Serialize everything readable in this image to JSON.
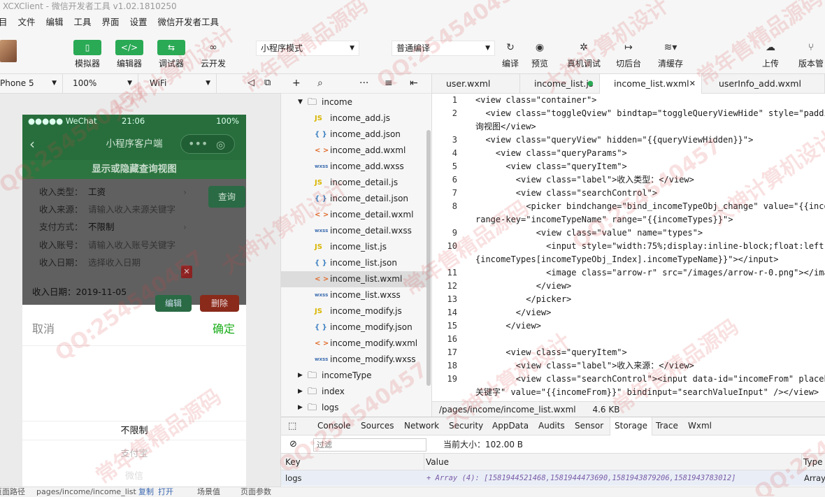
{
  "window": {
    "title": "XCXClient - 微信开发者工具 v1.02.1810250"
  },
  "menu": [
    "目",
    "文件",
    "编辑",
    "工具",
    "界面",
    "设置",
    "微信开发者工具"
  ],
  "toolbar": {
    "simulator": "模拟器",
    "editor": "编辑器",
    "debugger": "调试器",
    "cloud": "云开发",
    "mode": "小程序模式",
    "compile_mode": "普通编译",
    "compile": "编译",
    "preview": "预览",
    "remote_debug": "真机调试",
    "background": "切后台",
    "clear_cache": "清缓存",
    "upload": "上传",
    "version": "版本管"
  },
  "device_bar": {
    "device": "Phone 5",
    "zoom": "100%",
    "network": "WiFi"
  },
  "phone": {
    "carrier": "●●●●● WeChat",
    "time": "21:06",
    "battery": "100%",
    "nav_title": "小程序客户端",
    "toggle_label": "显示或隐藏查询视图",
    "query_button": "查询",
    "form": [
      {
        "label": "收入类型：",
        "value": "工资"
      },
      {
        "label": "收入来源：",
        "value": "请输入收入来源关键字"
      },
      {
        "label": "支付方式：",
        "value": "不限制"
      },
      {
        "label": "收入账号：",
        "value": "请输入收入账号关键字"
      },
      {
        "label": "收入日期：",
        "value": "选择收入日期"
      }
    ],
    "record_date": "收入日期：2019-11-05",
    "edit_button": "编辑",
    "delete_button": "删除",
    "picker": {
      "cancel": "取消",
      "confirm": "确定",
      "options": [
        "不限制",
        "支付宝",
        "微信"
      ]
    }
  },
  "statusbar": {
    "path_label": "页面路径",
    "path": "pages/income/income_list",
    "copy": "复制",
    "open": "打开",
    "scene": "场景值",
    "params": "页面参数"
  },
  "filetree": {
    "folder": "income",
    "files": [
      {
        "icon": "JS",
        "name": "income_add.js",
        "color": "#d9b600"
      },
      {
        "icon": "{ }",
        "name": "income_add.json",
        "color": "#3f82c2"
      },
      {
        "icon": "< >",
        "name": "income_add.wxml",
        "color": "#e06a2a"
      },
      {
        "icon": "wxss",
        "name": "income_add.wxss",
        "color": "#3f6fb0"
      },
      {
        "icon": "JS",
        "name": "income_detail.js",
        "color": "#d9b600"
      },
      {
        "icon": "{ }",
        "name": "income_detail.json",
        "color": "#3f82c2"
      },
      {
        "icon": "< >",
        "name": "income_detail.wxml",
        "color": "#e06a2a"
      },
      {
        "icon": "wxss",
        "name": "income_detail.wxss",
        "color": "#3f6fb0"
      },
      {
        "icon": "JS",
        "name": "income_list.js",
        "color": "#d9b600"
      },
      {
        "icon": "{ }",
        "name": "income_list.json",
        "color": "#3f82c2"
      },
      {
        "icon": "< >",
        "name": "income_list.wxml",
        "color": "#e06a2a"
      },
      {
        "icon": "wxss",
        "name": "income_list.wxss",
        "color": "#3f6fb0"
      },
      {
        "icon": "JS",
        "name": "income_modify.js",
        "color": "#d9b600"
      },
      {
        "icon": "{ }",
        "name": "income_modify.json",
        "color": "#3f82c2"
      },
      {
        "icon": "< >",
        "name": "income_modify.wxml",
        "color": "#e06a2a"
      },
      {
        "icon": "wxss",
        "name": "income_modify.wxss",
        "color": "#3f6fb0"
      }
    ],
    "folders": [
      "incomeType",
      "index",
      "logs"
    ]
  },
  "editor": {
    "tabs": [
      "user.wxml",
      "income_list.js",
      "income_list.wxml",
      "userInfo_add.wxml"
    ],
    "lines": [
      {
        "n": "1",
        "t": "<view class=\"container\">"
      },
      {
        "n": "2",
        "t": "  <view class=\"toggleQview\" bindtap=\"toggleQueryViewHide\" style=\"paddi"
      },
      {
        "n": "",
        "t": "询视图</view>"
      },
      {
        "n": "3",
        "t": "  <view class=\"queryView\" hidden=\"{{queryViewHidden}}\">"
      },
      {
        "n": "4",
        "t": "    <view class=\"queryParams\">"
      },
      {
        "n": "5",
        "t": "      <view class=\"queryItem\">"
      },
      {
        "n": "6",
        "t": "        <view class=\"label\">收入类型：</view>"
      },
      {
        "n": "7",
        "t": "        <view class=\"searchControl\">"
      },
      {
        "n": "8",
        "t": "          <picker bindchange=\"bind_incomeTypeObj_change\" value=\"{{inco"
      },
      {
        "n": "",
        "t": "range-key=\"incomeTypeName\" range=\"{{incomeTypes}}\">"
      },
      {
        "n": "9",
        "t": "            <view class=\"value\" name=\"types\">"
      },
      {
        "n": "10",
        "t": "              <input style=\"width:75%;display:inline-block;float:left;"
      },
      {
        "n": "",
        "t": "{incomeTypes[incomeTypeObj_Index].incomeTypeName}}\"></input>"
      },
      {
        "n": "11",
        "t": "              <image class=\"arrow-r\" src=\"/images/arrow-r-0.png\"></ima"
      },
      {
        "n": "12",
        "t": "            </view>"
      },
      {
        "n": "13",
        "t": "          </picker>"
      },
      {
        "n": "14",
        "t": "        </view>"
      },
      {
        "n": "15",
        "t": "      </view>"
      },
      {
        "n": "16",
        "t": ""
      },
      {
        "n": "17",
        "t": "      <view class=\"queryItem\">"
      },
      {
        "n": "18",
        "t": "        <view class=\"label\">收入来源：</view>"
      },
      {
        "n": "19",
        "t": "        <view class=\"searchControl\"><input data-id=\"incomeFrom\" placeh"
      },
      {
        "n": "",
        "t": "关键字\" value=\"{{incomeFrom}}\" bindinput=\"searchValueInput\" /></view>"
      }
    ],
    "file_path": "/pages/income/income_list.wxml",
    "file_size": "4.6 KB"
  },
  "devtools": {
    "tabs": [
      "Console",
      "Sources",
      "Network",
      "Security",
      "AppData",
      "Audits",
      "Sensor",
      "Storage",
      "Trace",
      "Wxml"
    ],
    "active_tab": "Storage",
    "filter_placeholder": "过滤",
    "current_size": "当前大小：102.00 B",
    "col_key": "Key",
    "col_value": "Value",
    "col_type": "Type",
    "row_key": "logs",
    "row_value": "+ Array (4): [1581944521468,1581944473690,1581943879206,1581943783012]",
    "row_type": "Array"
  },
  "watermarks": [
    "QQ:254540457",
    "大神计算机设计",
    "常年售精品源码",
    "QQ:254540457",
    "大神计算机设计",
    "常年售精品源码",
    "QQ:254540457",
    "大神计算机设计",
    "常年售精品源码",
    "QQ:254540457",
    "大神计算机设计",
    "常年售精品源码"
  ]
}
